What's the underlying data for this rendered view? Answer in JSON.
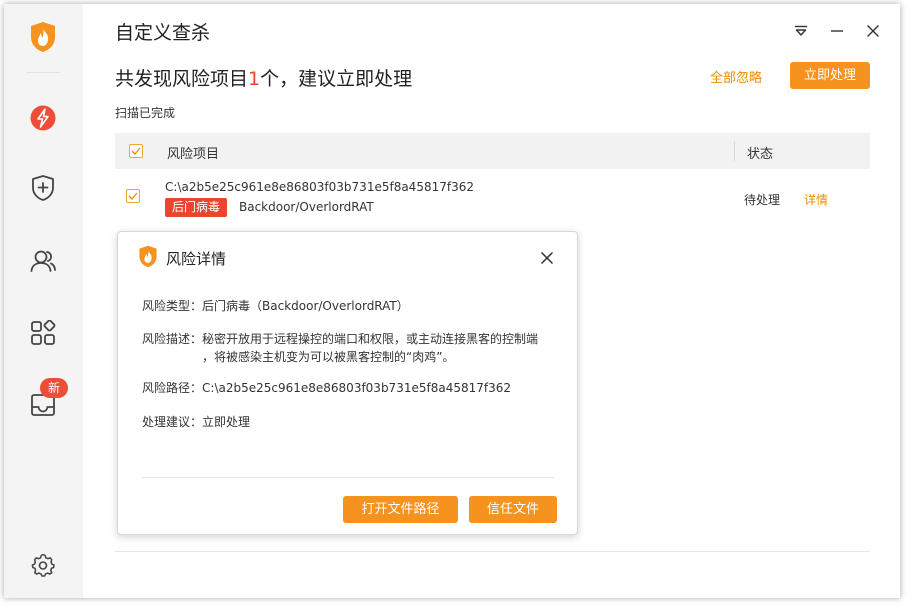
{
  "app": {
    "title": "自定义查杀",
    "new_badge": "新"
  },
  "sidebar": {
    "items": [
      {
        "icon": "brand-flame-shield-icon"
      },
      {
        "icon": "lightning-icon"
      },
      {
        "icon": "shield-plus-icon"
      },
      {
        "icon": "users-icon"
      },
      {
        "icon": "apps-grid-icon"
      },
      {
        "icon": "inbox-icon"
      },
      {
        "icon": "settings-gear-icon"
      }
    ]
  },
  "header": {
    "summary_prefix": "共发现风险项目",
    "risk_count": "1",
    "summary_suffix": "个，建议立即处理",
    "ignore_all": "全部忽略",
    "fix_now": "立即处理",
    "scan_status": "扫描已完成"
  },
  "table": {
    "col_item": "风险项目",
    "col_status": "状态",
    "rows": [
      {
        "path": "C:\\a2b5e25c961e8e86803f03b731e5f8a45817f362",
        "tag": "后门病毒",
        "virus": "Backdoor/OverlordRAT",
        "state": "待处理",
        "detail": "详情"
      }
    ]
  },
  "popup": {
    "title": "风险详情",
    "type_label": "风险类型：",
    "type_value": "后门病毒（Backdoor/OverlordRAT）",
    "desc_label": "风险描述：",
    "desc_line1": "秘密开放用于远程操控的端口和权限，或主动连接黑客的控制端",
    "desc_line2": "，将被感染主机变为可以被黑客控制的“肉鸡”。",
    "path_label": "风险路径：",
    "path_value": "C:\\a2b5e25c961e8e86803f03b731e5f8a45817f362",
    "advice_label": "处理建议：",
    "advice_value": "立即处理",
    "open_path_button": "打开文件路径",
    "trust_button": "信任文件"
  },
  "colors": {
    "accent": "#f6921e",
    "danger": "#e9452f",
    "link": "#f08c00"
  }
}
